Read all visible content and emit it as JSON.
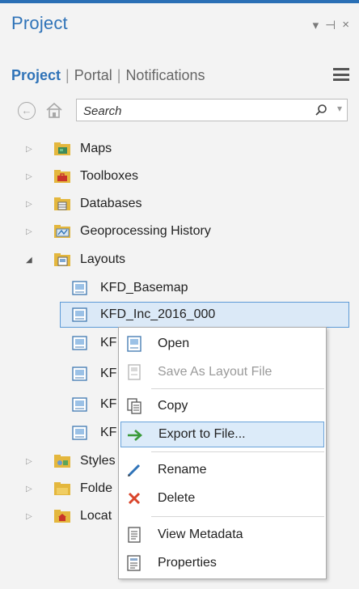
{
  "pane": {
    "title": "Project",
    "controls": {
      "dropdown": "▾",
      "pin": "⊣",
      "close": "×"
    }
  },
  "tabs": [
    {
      "label": "Project",
      "active": true
    },
    {
      "label": "Portal",
      "active": false
    },
    {
      "label": "Notifications",
      "active": false
    }
  ],
  "tab_separator": "|",
  "toolbar": {
    "search_placeholder": "Search",
    "back_glyph": "←",
    "dropdown_glyph": "▾"
  },
  "tree": {
    "top_items": [
      {
        "label": "Maps",
        "icon": "maps-folder-icon",
        "expanded": false
      },
      {
        "label": "Toolboxes",
        "icon": "toolboxes-folder-icon",
        "expanded": false
      },
      {
        "label": "Databases",
        "icon": "databases-folder-icon",
        "expanded": false
      },
      {
        "label": "Geoprocessing History",
        "icon": "geoprocessing-history-icon",
        "expanded": false
      },
      {
        "label": "Layouts",
        "icon": "layouts-folder-icon",
        "expanded": true
      }
    ],
    "layout_items": [
      {
        "label": "KFD_Basemap"
      },
      {
        "label": "KFD_Inc_2016_000",
        "selected": true
      },
      {
        "label": "KF"
      },
      {
        "label": "KF"
      },
      {
        "label": "KF"
      },
      {
        "label": "KF"
      }
    ],
    "bottom_items": [
      {
        "label": "Styles",
        "icon": "styles-folder-icon"
      },
      {
        "label": "Folde",
        "icon": "folders-icon"
      },
      {
        "label": "Locat",
        "icon": "locators-folder-icon"
      }
    ],
    "collapsed_glyph": "▷",
    "expanded_glyph": "◢"
  },
  "context_menu": {
    "items": [
      {
        "label": "Open",
        "icon": "open-layout-icon",
        "enabled": true
      },
      {
        "label": "Save As Layout File",
        "icon": "save-layout-file-icon",
        "enabled": false
      },
      {
        "label": "Copy",
        "icon": "copy-icon",
        "enabled": true
      },
      {
        "label": "Export to File...",
        "icon": "export-arrow-icon",
        "enabled": true,
        "highlighted": true
      },
      {
        "label": "Rename",
        "icon": "rename-pencil-icon",
        "enabled": true
      },
      {
        "label": "Delete",
        "icon": "delete-x-icon",
        "enabled": true
      },
      {
        "label": "View Metadata",
        "icon": "view-metadata-icon",
        "enabled": true
      },
      {
        "label": "Properties",
        "icon": "properties-icon",
        "enabled": true
      }
    ]
  },
  "colors": {
    "accent": "#2f73b8",
    "selection_bg": "#dbe9f7",
    "selection_border": "#5d9ad6",
    "export_arrow": "#3a9a3a",
    "delete_x": "#d9452b"
  }
}
